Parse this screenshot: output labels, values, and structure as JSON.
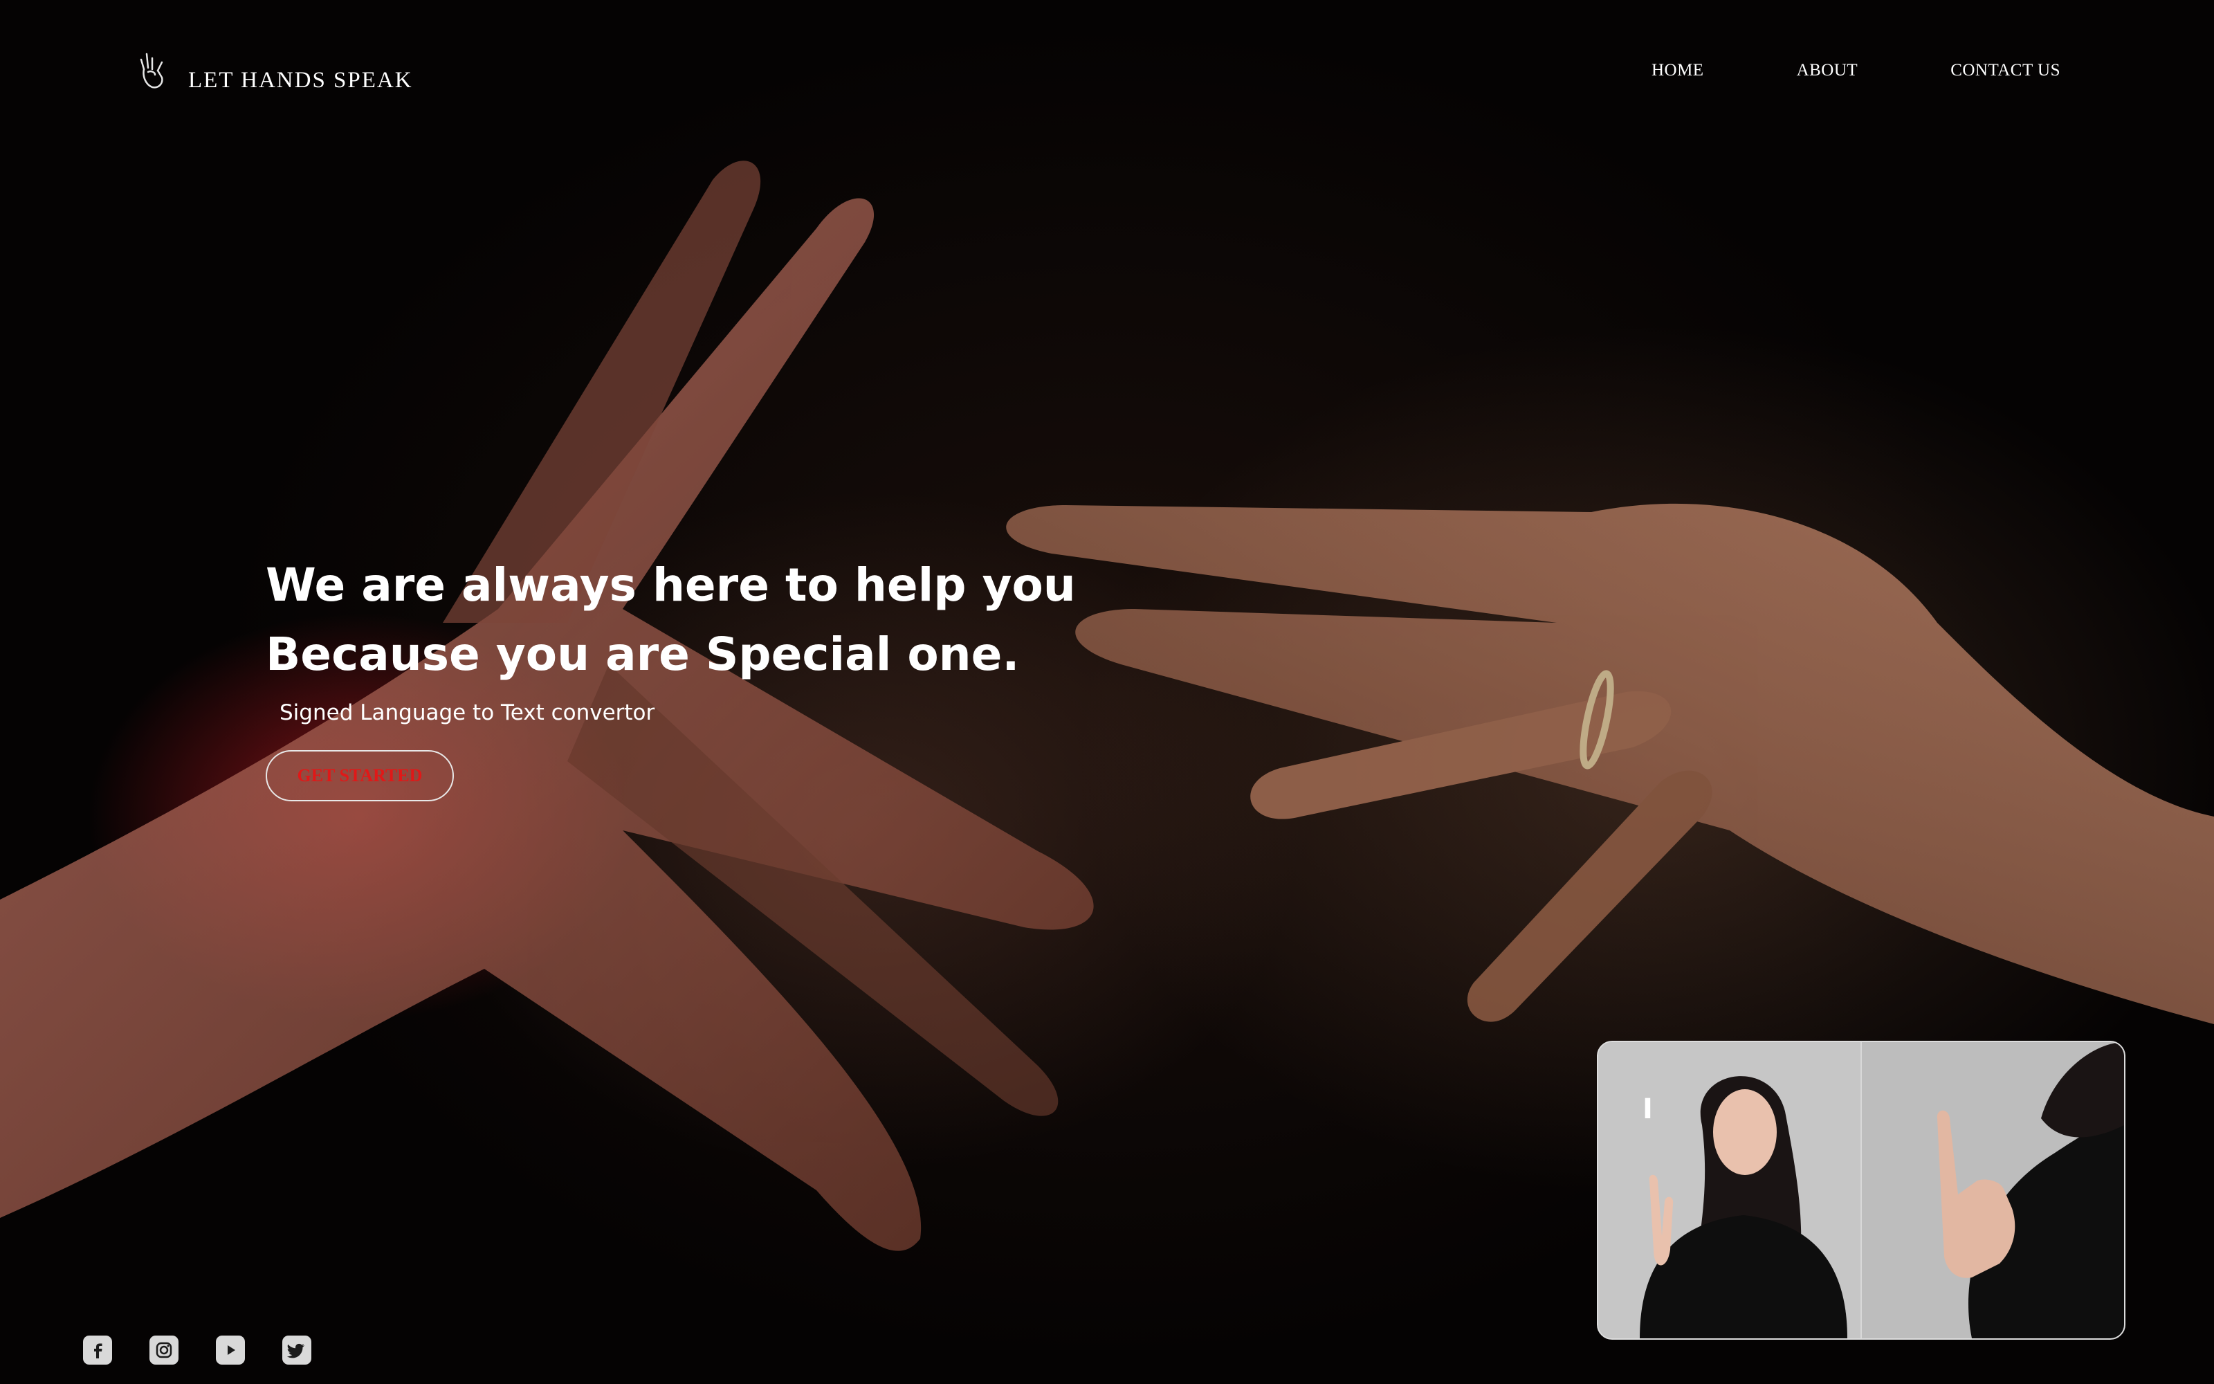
{
  "brand": {
    "name": "LET HANDS SPEAK",
    "icon": "hand-sign-icon"
  },
  "nav": {
    "items": [
      {
        "label": "HOME"
      },
      {
        "label": "ABOUT"
      },
      {
        "label": "CONTACT US"
      }
    ]
  },
  "hero": {
    "headline_line1": "We are always here to help you",
    "headline_line2": "Because you are Special one.",
    "subtitle": "Signed Language to Text convertor",
    "cta_label": "GET STARTED",
    "cta_color": "#e01818"
  },
  "video": {
    "caption": "I"
  },
  "socials": [
    {
      "icon": "facebook-icon"
    },
    {
      "icon": "instagram-icon"
    },
    {
      "icon": "youtube-icon"
    },
    {
      "icon": "twitter-icon"
    }
  ]
}
